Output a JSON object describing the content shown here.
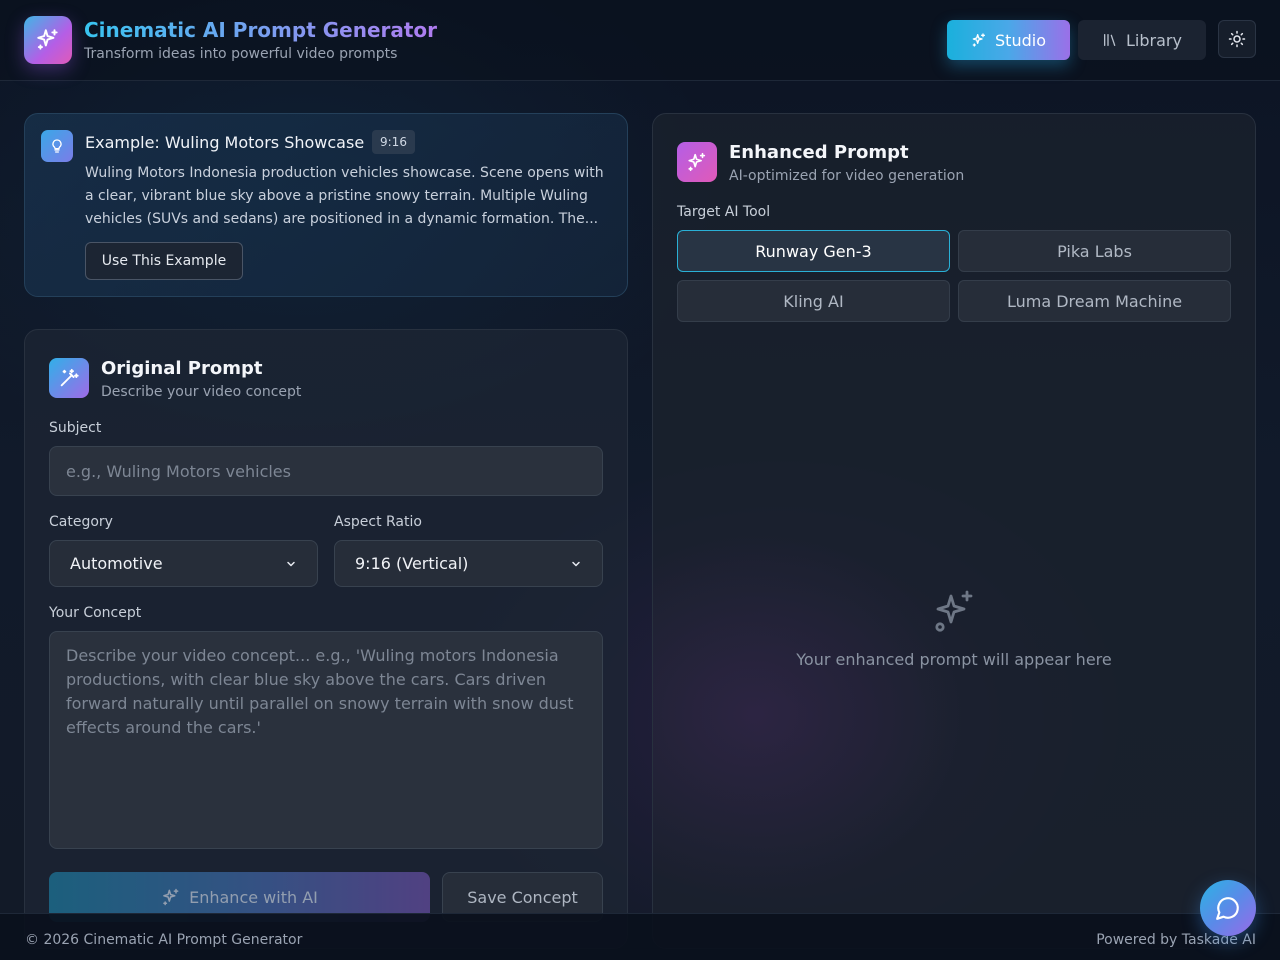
{
  "header": {
    "title": "Cinematic AI Prompt Generator",
    "subtitle": "Transform ideas into powerful video prompts",
    "nav": {
      "studio": "Studio",
      "library": "Library"
    }
  },
  "example": {
    "title": "Example: Wuling Motors Showcase",
    "badge": "9:16",
    "text": "Wuling Motors Indonesia production vehicles showcase. Scene opens with a clear, vibrant blue sky above a pristine snowy terrain. Multiple Wuling vehicles (SUVs and sedans) are positioned in a dynamic formation. The...",
    "button": "Use This Example"
  },
  "original": {
    "title": "Original Prompt",
    "subtitle": "Describe your video concept",
    "subject_label": "Subject",
    "subject_placeholder": "e.g., Wuling Motors vehicles",
    "category_label": "Category",
    "category_value": "Automotive",
    "aspect_label": "Aspect Ratio",
    "aspect_value": "9:16 (Vertical)",
    "concept_label": "Your Concept",
    "concept_placeholder": "Describe your video concept... e.g., 'Wuling motors Indonesia productions, with clear blue sky above the cars. Cars driven forward naturally until parallel on snowy terrain with snow dust effects around the cars.'",
    "enhance_button": "Enhance with AI",
    "save_button": "Save Concept"
  },
  "enhanced": {
    "title": "Enhanced Prompt",
    "subtitle": "AI-optimized for video generation",
    "tool_label": "Target AI Tool",
    "tools": [
      "Runway Gen-3",
      "Pika Labs",
      "Kling AI",
      "Luma Dream Machine"
    ],
    "selected_tool": "Runway Gen-3",
    "empty_text": "Your enhanced prompt will appear here"
  },
  "footer": {
    "copyright": "© 2026 Cinematic AI Prompt Generator",
    "powered": "Powered by Taskade AI"
  },
  "colors": {
    "accent_cyan": "#1ab0dc",
    "accent_purple": "#9a70e8",
    "accent_pink": "#e05ab8",
    "background": "#0c1424"
  }
}
